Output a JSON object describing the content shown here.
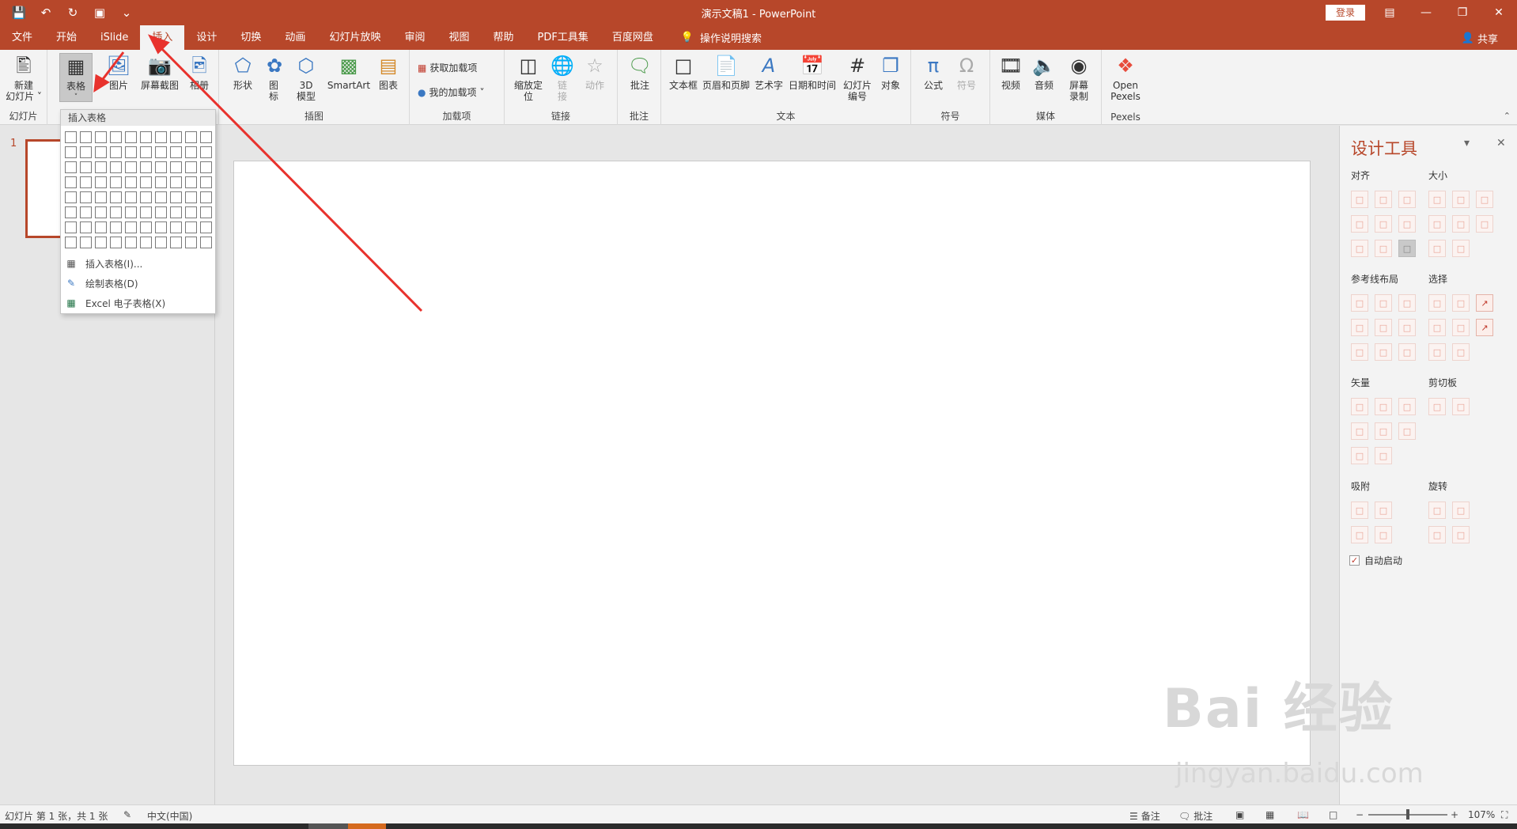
{
  "window": {
    "title": "演示文稿1 - PowerPoint",
    "login_label": "登录",
    "share_label": "共享"
  },
  "tabs": [
    "文件",
    "开始",
    "iSlide",
    "插入",
    "设计",
    "切换",
    "动画",
    "幻灯片放映",
    "审阅",
    "视图",
    "帮助",
    "PDF工具集",
    "百度网盘"
  ],
  "active_tab": "插入",
  "tell_me": "操作说明搜索",
  "ribbon": {
    "slides": {
      "label": "幻灯片",
      "new_slide": "新建\n幻灯片 ˅"
    },
    "tables": {
      "table": "表格"
    },
    "images": {
      "picture": "图片",
      "screenshot": "屏幕截图",
      "album": "相册"
    },
    "illustrations": {
      "label": "插图",
      "shapes": "形状",
      "icons": "图\n标",
      "model3d": "3D\n模型",
      "smartart": "SmartArt",
      "chart": "图表"
    },
    "addins": {
      "label": "加载项",
      "get": "获取加载项",
      "mine": "我的加载项"
    },
    "links": {
      "label": "链接",
      "zoom": "缩放定\n位",
      "link": "链\n接",
      "action": "动作"
    },
    "comments": {
      "label": "批注",
      "comment": "批注"
    },
    "text": {
      "label": "文本",
      "textbox": "文本框",
      "header_footer": "页眉和页脚",
      "wordart": "艺术字",
      "datetime": "日期和时间",
      "slide_number": "幻灯片\n编号",
      "object": "对象"
    },
    "symbols": {
      "label": "符号",
      "equation": "公式",
      "symbol": "符号"
    },
    "media": {
      "label": "媒体",
      "video": "视频",
      "audio": "音频",
      "screen_record": "屏幕\n录制"
    },
    "pexels": {
      "label": "Pexels",
      "open": "Open\nPexels"
    }
  },
  "dropdown": {
    "header": "插入表格",
    "items": [
      "插入表格(I)...",
      "绘制表格(D)",
      "Excel 电子表格(X)"
    ]
  },
  "slide_thumb_number": "1",
  "design_pane": {
    "title": "设计工具",
    "sections": {
      "align": "对齐",
      "size": "大小",
      "guides": "参考线布局",
      "select": "选择",
      "vector": "矢量",
      "clipboard": "剪切板",
      "snap": "吸附",
      "rotate": "旋转"
    },
    "auto_start": "自动启动"
  },
  "watermark": {
    "main": "Bai 经验",
    "sub": "jingyan.baidu.com"
  },
  "status": {
    "slide_info": "幻灯片 第 1 张，共 1 张",
    "language": "中文(中国)",
    "notes": "备注",
    "comments": "批注",
    "zoom": "107%"
  },
  "colors": {
    "accent": "#b7472a",
    "annotation": "#e8322d"
  }
}
